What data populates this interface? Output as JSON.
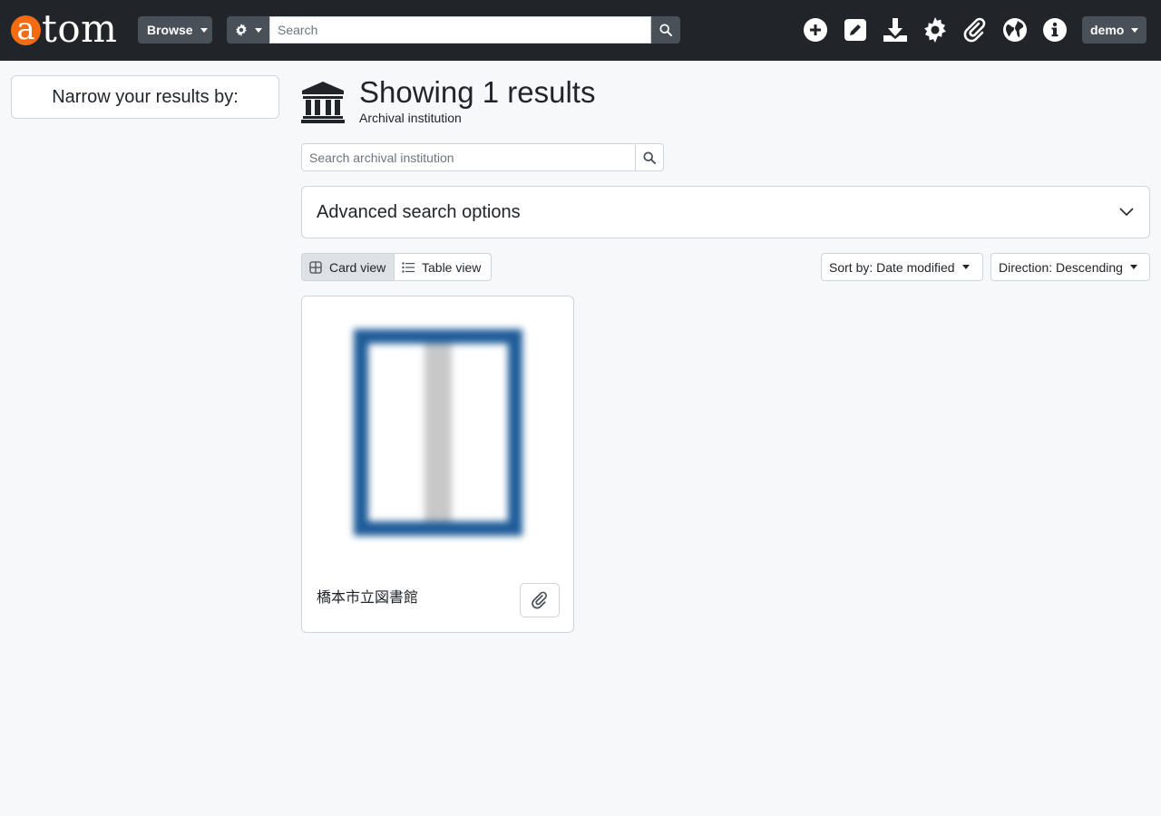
{
  "header": {
    "logo_first": "a",
    "logo_rest": "tom",
    "browse_label": "Browse",
    "search_placeholder": "Search",
    "user_label": "demo",
    "icons": [
      "plus-circle-icon",
      "edit-icon",
      "download-icon",
      "gear-icon",
      "paperclip-icon",
      "globe-icon",
      "info-icon"
    ],
    "brand_color": "#f46b12"
  },
  "sidebar": {
    "narrow_label": "Narrow your results by:"
  },
  "main": {
    "title": "Showing 1 results",
    "subtitle": "Archival institution",
    "search_placeholder": "Search archival institution",
    "advanced_label": "Advanced search options",
    "views": {
      "card": "Card view",
      "table": "Table view",
      "active": "card"
    },
    "sort_label": "Sort by: Date modified",
    "direction_label": "Direction: Descending"
  },
  "results": [
    {
      "title": "橋本市立図書館"
    }
  ]
}
